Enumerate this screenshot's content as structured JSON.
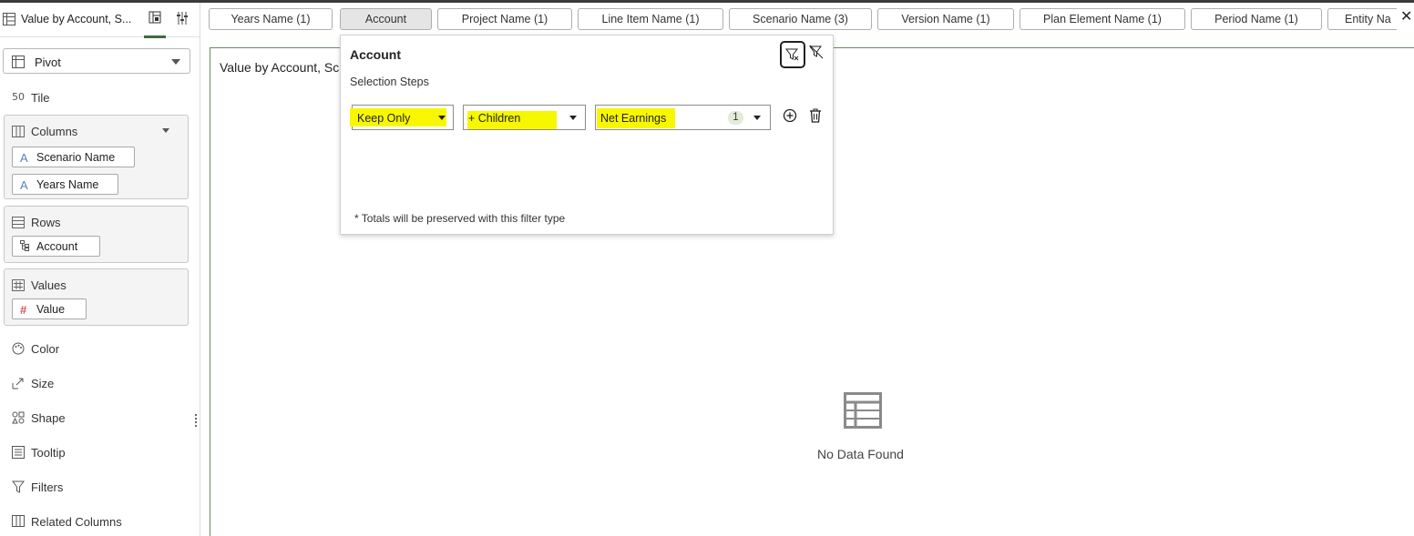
{
  "left_panel": {
    "title": "Value by Account, S...",
    "viz_type": "Pivot",
    "tile_label": "Tile",
    "columns": {
      "label": "Columns",
      "items": [
        "Scenario Name",
        "Years Name"
      ]
    },
    "rows": {
      "label": "Rows",
      "items": [
        "Account"
      ]
    },
    "values": {
      "label": "Values",
      "items": [
        "Value"
      ]
    },
    "properties": [
      "Color",
      "Size",
      "Shape",
      "Tooltip",
      "Filters",
      "Related Columns"
    ]
  },
  "filter_bar": {
    "chips": [
      "Years Name (1)",
      "Account",
      "Project Name (1)",
      "Line Item Name (1)",
      "Scenario Name (3)",
      "Version Name (1)",
      "Plan Element Name (1)",
      "Period Name (1)",
      "Entity Na"
    ],
    "active_index": 1
  },
  "canvas": {
    "title": "Value by Account, Sc",
    "empty_message": "No Data Found"
  },
  "popup": {
    "title": "Account",
    "subtitle": "Selection Steps",
    "step": {
      "action": "Keep Only",
      "relation": "+ Children",
      "member": "Net Earnings",
      "member_count": "1"
    },
    "note": "* Totals will be preserved with this filter type"
  },
  "colors": {
    "highlight": "#f7f700",
    "accent_green": "#3f6b3f",
    "measure_icon": "#d9534f",
    "attribute_icon": "#5b7fb3"
  }
}
